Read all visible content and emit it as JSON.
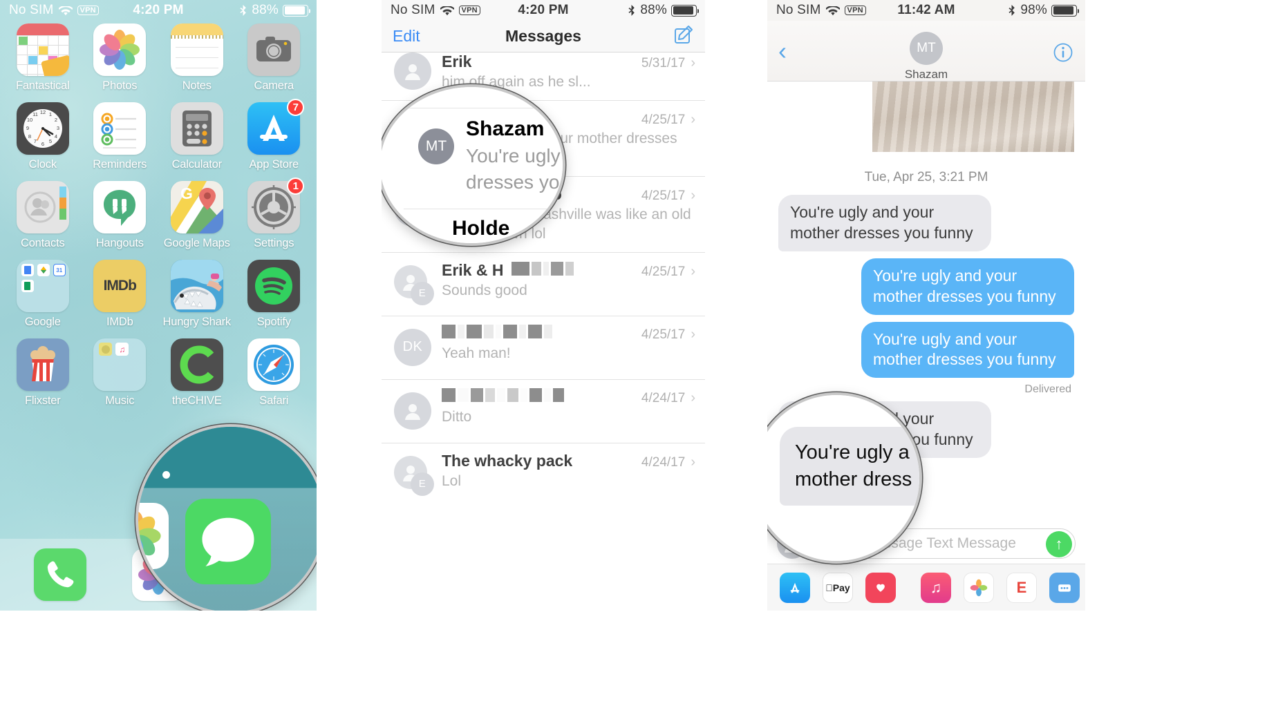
{
  "panel1": {
    "status": {
      "carrier": "No SIM",
      "vpn": "VPN",
      "time": "4:20 PM",
      "battery": "88%"
    },
    "apps": [
      {
        "label": "Fantastical",
        "icon": "calendar-icon",
        "badge": null
      },
      {
        "label": "Photos",
        "icon": "photos-icon",
        "badge": null
      },
      {
        "label": "Notes",
        "icon": "notes-icon",
        "badge": null
      },
      {
        "label": "Camera",
        "icon": "camera-icon",
        "badge": null
      },
      {
        "label": "Clock",
        "icon": "clock-icon",
        "badge": null
      },
      {
        "label": "Reminders",
        "icon": "reminders-icon",
        "badge": null
      },
      {
        "label": "Calculator",
        "icon": "calculator-icon",
        "badge": null
      },
      {
        "label": "App Store",
        "icon": "app-store-icon",
        "badge": "7"
      },
      {
        "label": "Contacts",
        "icon": "contacts-icon",
        "badge": null
      },
      {
        "label": "Hangouts",
        "icon": "hangouts-icon",
        "badge": null
      },
      {
        "label": "Google Maps",
        "icon": "google-maps-icon",
        "badge": null
      },
      {
        "label": "Settings",
        "icon": "settings-gear-icon",
        "badge": "1"
      },
      {
        "label": "Google",
        "icon": "folder-google-icon",
        "badge": null
      },
      {
        "label": "IMDb",
        "icon": "imdb-icon",
        "badge": null
      },
      {
        "label": "Hungry Shark",
        "icon": "hungry-shark-icon",
        "badge": null
      },
      {
        "label": "Spotify",
        "icon": "spotify-icon",
        "badge": null
      },
      {
        "label": "Flixster",
        "icon": "flixster-popcorn-icon",
        "badge": null
      },
      {
        "label": "Music",
        "icon": "folder-music-icon",
        "badge": null
      },
      {
        "label": "theCHIVE",
        "icon": "thechive-icon",
        "badge": null
      },
      {
        "label": "Safari",
        "icon": "safari-compass-icon",
        "badge": null
      }
    ],
    "dock": [
      {
        "label": "Phone",
        "icon": "phone-icon"
      },
      {
        "label": "Photos",
        "icon": "photos-icon"
      },
      {
        "label": "Messages",
        "icon": "messages-icon"
      }
    ],
    "page_dots": 3,
    "page_active": 1
  },
  "panel2": {
    "status": {
      "carrier": "No SIM",
      "vpn": "VPN",
      "time": "4:20 PM",
      "battery": "88%"
    },
    "nav": {
      "left": "Edit",
      "title": "Messages",
      "compose_icon": "compose-icon"
    },
    "rows": [
      {
        "name": "Erik",
        "redacted": false,
        "avatar": "",
        "preview": "him off again as he sl...",
        "date": "5/31/17"
      },
      {
        "name": "Shazam",
        "redacted": false,
        "avatar": "MT",
        "preview": "You're ugly and your mother dresses you funny",
        "date": "4/25/17"
      },
      {
        "name": "Holden Sheinko",
        "redacted": false,
        "avatar": "",
        "preview": "Like I thought Nashville was like an old western town lol",
        "date": "4/25/17"
      },
      {
        "name": "Erik & H",
        "redacted": true,
        "avatar": "E",
        "preview": "Sounds good",
        "date": "4/25/17"
      },
      {
        "name": "",
        "redacted": true,
        "avatar": "DK",
        "preview": "Yeah man!",
        "date": "4/25/17"
      },
      {
        "name": "",
        "redacted": true,
        "avatar": "",
        "preview": "Ditto",
        "date": "4/24/17"
      },
      {
        "name": "The whacky pack",
        "redacted": false,
        "avatar": "E",
        "preview": "Lol",
        "date": "4/24/17"
      }
    ],
    "magnifier": {
      "name": "Shazam",
      "avatar": "MT",
      "preview_line1": "You're ugly",
      "preview_line2": "dresses yo"
    }
  },
  "panel3": {
    "status": {
      "carrier": "No SIM",
      "vpn": "VPN",
      "time": "11:42 AM",
      "battery": "98%"
    },
    "nav": {
      "back_icon": "back-chevron-icon",
      "avatar": "MT",
      "name": "Shazam",
      "info_icon": "info-icon"
    },
    "daystamp": "Tue, Apr 25, 3:21 PM",
    "messages": [
      {
        "dir": "in",
        "text": "You're ugly and your mother dresses you funny"
      },
      {
        "dir": "out",
        "text": "You're ugly and your mother dresses you funny"
      },
      {
        "dir": "out",
        "text": "You're ugly and your mother dresses you funny"
      },
      {
        "dir": "in",
        "text": "You're ugly and your mother dresses you funny"
      }
    ],
    "delivered_label": "Delivered",
    "composer": {
      "placeholder": "iMessage Text Message",
      "send_icon": "send-arrow-icon"
    },
    "drawer_icons": [
      "app-store-icon",
      "apple-pay-icon",
      "digital-touch-icon",
      "music-icon",
      "photos-icon",
      "e-app-icon",
      "more-apps-icon"
    ],
    "magnifier": {
      "line1": "You're ugly a",
      "line2": "mother dress"
    }
  },
  "colors": {
    "ios_blue": "#3a8bf5",
    "bubble_in": "#e9e9ed",
    "bubble_out": "#5ab5f7",
    "badge_red": "#fc3d39",
    "send_green": "#4cd964"
  }
}
